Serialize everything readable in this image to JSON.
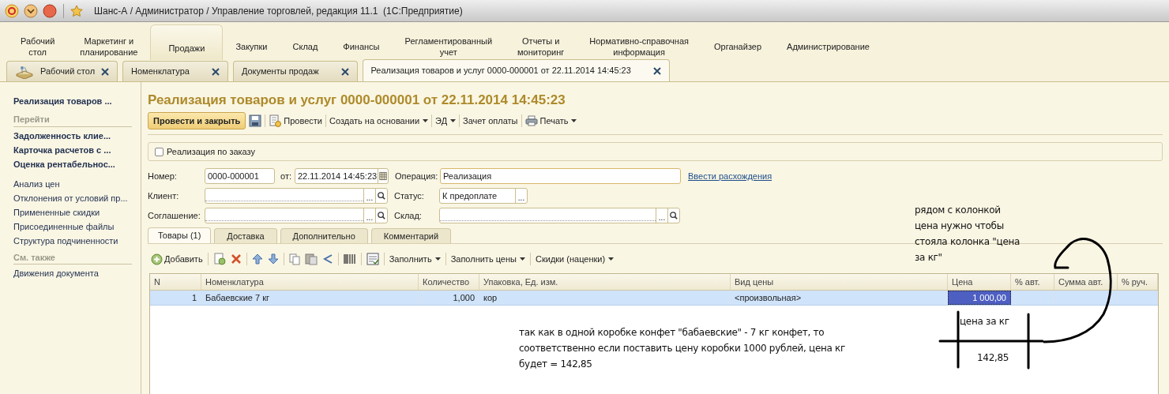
{
  "window": {
    "title": "Шанс-А / Администратор / Управление торговлей, редакция 11.1  (1С:Предприятие)"
  },
  "sections": [
    {
      "label": "Рабочий\nстол",
      "selected": false
    },
    {
      "label": "Маркетинг и\nпланирование",
      "selected": false
    },
    {
      "label": "Продажи",
      "selected": true
    },
    {
      "label": "Закупки",
      "selected": false
    },
    {
      "label": "Склад",
      "selected": false
    },
    {
      "label": "Финансы",
      "selected": false
    },
    {
      "label": "Регламентированный\nучет",
      "selected": false
    },
    {
      "label": "Отчеты и\nмониторинг",
      "selected": false
    },
    {
      "label": "Нормативно-справочная\nинформация",
      "selected": false
    },
    {
      "label": "Органайзер",
      "selected": false
    },
    {
      "label": "Администрирование",
      "selected": false
    }
  ],
  "open_tabs": [
    {
      "label": "Рабочий стол",
      "selected": false,
      "kind": "desktop"
    },
    {
      "label": "Номенклатура",
      "selected": false,
      "kind": "plain"
    },
    {
      "label": "Документы продаж",
      "selected": false,
      "kind": "plain"
    },
    {
      "label": "Реализация товаров и услуг 0000-000001 от 22.11.2014 14:45:23",
      "selected": true,
      "kind": "plain"
    }
  ],
  "sidebar": {
    "items": [
      {
        "kind": "title",
        "label": "Реализация товаров ..."
      },
      {
        "kind": "heading",
        "label": "Перейти"
      },
      {
        "kind": "bold",
        "label": "Задолженность клие..."
      },
      {
        "kind": "bold",
        "label": "Карточка расчетов с ..."
      },
      {
        "kind": "bold",
        "label": "Оценка рентабельнос..."
      },
      {
        "kind": "gap"
      },
      {
        "kind": "link",
        "label": "Анализ цен"
      },
      {
        "kind": "link",
        "label": "Отклонения от условий пр..."
      },
      {
        "kind": "link",
        "label": "Примененные скидки"
      },
      {
        "kind": "link",
        "label": "Присоединенные файлы"
      },
      {
        "kind": "link",
        "label": "Структура подчиненности"
      },
      {
        "kind": "heading",
        "label": "См. также"
      },
      {
        "kind": "link",
        "label": "Движения документа"
      }
    ]
  },
  "document": {
    "title": "Реализация товаров и услуг 0000-000001 от 22.11.2014 14:45:23",
    "toolbar": [
      {
        "kind": "primary",
        "label": "Провести и закрыть"
      },
      {
        "kind": "save"
      },
      {
        "kind": "post",
        "label": "Провести"
      },
      {
        "kind": "menu",
        "label": "Создать на основании"
      },
      {
        "kind": "menu",
        "label": "ЭД"
      },
      {
        "kind": "plain",
        "label": "Зачет оплаты"
      },
      {
        "kind": "print",
        "label": "Печать"
      }
    ],
    "order_checkbox": {
      "label": "Реализация по заказу",
      "checked": false
    },
    "field_rows": [
      [
        {
          "kind": "number",
          "label": "Номер:",
          "value": "0000-000001"
        },
        {
          "kind": "date",
          "label": "от:",
          "value": "22.11.2014 14:45:23"
        },
        {
          "kind": "wide",
          "label": "Операция:",
          "value": "Реализация"
        },
        {
          "kind": "link",
          "label": "Ввести расхождения"
        }
      ],
      [
        {
          "kind": "ref",
          "label": "Клиент:",
          "choice": "..."
        },
        {
          "kind": "status",
          "label": "Статус:",
          "value": "К предоплате",
          "choice": "..."
        }
      ],
      [
        {
          "kind": "ref",
          "label": "Соглашение:",
          "choice": "..."
        },
        {
          "kind": "refwide",
          "label": "Склад:",
          "choice": "..."
        }
      ]
    ],
    "tabs": [
      {
        "label": "Товары (1)",
        "selected": true
      },
      {
        "label": "Доставка",
        "selected": false
      },
      {
        "label": "Дополнительно",
        "selected": false
      },
      {
        "label": "Комментарий",
        "selected": false
      }
    ],
    "table_toolbar": [
      {
        "kind": "add",
        "label": "Добавить"
      },
      {
        "kind": "sep"
      },
      {
        "kind": "newrow"
      },
      {
        "kind": "delete"
      },
      {
        "kind": "sep"
      },
      {
        "kind": "up"
      },
      {
        "kind": "down"
      },
      {
        "kind": "sep"
      },
      {
        "kind": "copy"
      },
      {
        "kind": "paste"
      },
      {
        "kind": "branch"
      },
      {
        "kind": "sep"
      },
      {
        "kind": "barcode"
      },
      {
        "kind": "sep"
      },
      {
        "kind": "report"
      },
      {
        "kind": "sep"
      },
      {
        "kind": "menu",
        "label": "Заполнить"
      },
      {
        "kind": "sep"
      },
      {
        "kind": "menu",
        "label": "Заполнить цены"
      },
      {
        "kind": "sep"
      },
      {
        "kind": "menu",
        "label": "Скидки (наценки)"
      }
    ],
    "table": {
      "columns": [
        "N",
        "Номенклатура",
        "Количество",
        "Упаковка, Ед. изм.",
        "Вид цены",
        "Цена",
        "% авт.",
        "Сумма авт.",
        "% руч."
      ],
      "rows": [
        {
          "selected": true,
          "cells": [
            {
              "text": "1",
              "focused": false
            },
            {
              "text": "Бабаевские 7 кг",
              "focused": false
            },
            {
              "text": "1,000",
              "focused": false
            },
            {
              "text": "кор",
              "focused": false
            },
            {
              "text": "<произвольная>",
              "focused": false
            },
            {
              "text": "1 000,00",
              "focused": true
            },
            {
              "focused": false
            },
            {
              "focused": false
            },
            {
              "focused": false
            }
          ]
        }
      ]
    }
  },
  "annotations": [
    {
      "kind": "request",
      "text": "рядом с колонкой\nцена нужно чтобы\nстояла колонка \"цена\nза кг\""
    },
    {
      "kind": "explanation",
      "text": "так как в одной коробке конфет \"бабаевские\" - 7 кг конфет, то\nсоответственно если поставить цену коробки 1000 рублей, цена кг\nбудет = 142,85"
    },
    {
      "kind": "column",
      "text": "цена за кг"
    },
    {
      "kind": "value",
      "text": "142,85"
    }
  ]
}
